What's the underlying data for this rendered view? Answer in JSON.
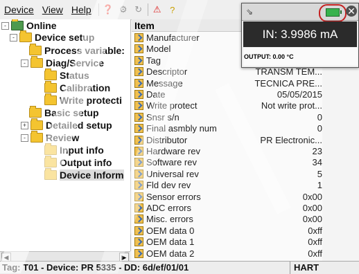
{
  "menu": {
    "device": "Device",
    "view": "View",
    "help": "Help"
  },
  "toolbar": {
    "icons": [
      "help-icon",
      "device-icon",
      "refresh-icon",
      "warning-icon",
      "help-icon"
    ]
  },
  "tree": {
    "root": "Online",
    "items": [
      {
        "label": "Device setup"
      },
      {
        "label": "Process variable:"
      },
      {
        "label": "Diag/Service"
      },
      {
        "label": "Status"
      },
      {
        "label": "Calibration"
      },
      {
        "label": "Write protecti"
      },
      {
        "label": "Basic setup"
      },
      {
        "label": "Detailed setup"
      },
      {
        "label": "Review"
      },
      {
        "label": "Input info"
      },
      {
        "label": "Output info"
      },
      {
        "label": "Device Inform"
      }
    ]
  },
  "list": {
    "header": "Item",
    "rows": [
      {
        "name": "Manufacturer",
        "value": ""
      },
      {
        "name": "Model",
        "value": ""
      },
      {
        "name": "Tag",
        "value": ""
      },
      {
        "name": "Descriptor",
        "value": "TRANSM TEM..."
      },
      {
        "name": "Message",
        "value": "TECNICA PRE..."
      },
      {
        "name": "Date",
        "value": "05/05/2015"
      },
      {
        "name": "Write protect",
        "value": "Not write prot..."
      },
      {
        "name": "Snsr s/n",
        "value": "0"
      },
      {
        "name": "Final asmbly num",
        "value": "0"
      },
      {
        "name": "Distributor",
        "value": "PR Electronic..."
      },
      {
        "name": "Hardware rev",
        "value": "23"
      },
      {
        "name": "Software rev",
        "value": "34"
      },
      {
        "name": "Universal rev",
        "value": "5"
      },
      {
        "name": "Fld dev rev",
        "value": "1"
      },
      {
        "name": "Sensor errors",
        "value": "0x00"
      },
      {
        "name": "ADC errors",
        "value": "0x00"
      },
      {
        "name": "Misc. errors",
        "value": "0x00"
      },
      {
        "name": "OEM data 0",
        "value": "0xff"
      },
      {
        "name": "OEM data 1",
        "value": "0xff"
      },
      {
        "name": "OEM data 2",
        "value": "0xff"
      }
    ]
  },
  "overlay": {
    "reading": "IN: 3.9986 mA",
    "output": "OUTPUT: 0.00 °C",
    "battery_color": "#37b24d"
  },
  "status": {
    "left": "Tag: T01     - Device: PR 5335 - DD: 6d/ef/01/01",
    "right": "HART"
  }
}
